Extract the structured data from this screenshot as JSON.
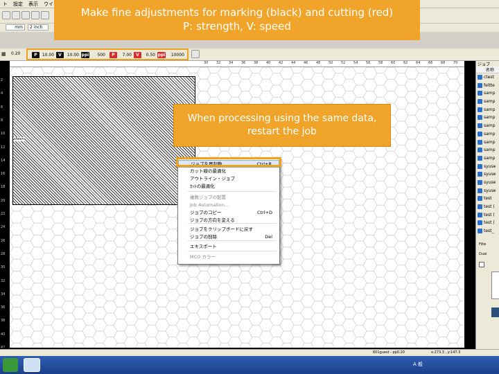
{
  "menubar": {
    "items": [
      "ト",
      "設定",
      "表示",
      "ウイン"
    ]
  },
  "toolbar2": {
    "value1": "mm",
    "value2": "2 inch"
  },
  "toolbar3": {
    "left_value": "0.20"
  },
  "params_black": {
    "p_label": "P",
    "p_value": "10.00",
    "v_label": "V",
    "v_value": "10.00",
    "ppi_value": "500"
  },
  "params_red": {
    "p_label": "P",
    "p_value": "7.00",
    "v_label": "V",
    "v_value": "0.50",
    "ppi_value": "10000"
  },
  "ruler_top": [
    "30",
    "32",
    "34",
    "36",
    "38",
    "40",
    "42",
    "44",
    "46",
    "48",
    "50",
    "52",
    "54",
    "56",
    "58",
    "60",
    "62",
    "64",
    "66",
    "68",
    "70",
    "72"
  ],
  "ruler_left": [
    "2",
    "4",
    "6",
    "8",
    "10",
    "12",
    "14",
    "16",
    "18",
    "20",
    "22",
    "24",
    "26",
    "28",
    "30",
    "32",
    "34",
    "36",
    "38",
    "40",
    "42"
  ],
  "job_label": "sfwen",
  "context_menu": {
    "items": [
      {
        "label": "ジョブを再起動",
        "shortcut": "Ctrl+R",
        "state": "selected"
      },
      {
        "label": "カット線の最適化",
        "shortcut": "",
        "state": "normal"
      },
      {
        "label": "アウトライン・ジョブ",
        "shortcut": "",
        "state": "normal"
      },
      {
        "label": "ｶｯﾄの最適化",
        "shortcut": "",
        "state": "normal"
      },
      {
        "label": "複数ジョブの配置",
        "shortcut": "",
        "state": "disabled"
      },
      {
        "label": "Job Automation...",
        "shortcut": "",
        "state": "disabled"
      },
      {
        "label": "ジョブのコピー",
        "shortcut": "Ctrl+D",
        "state": "normal"
      },
      {
        "label": "ジョブの方向を変える",
        "shortcut": "",
        "state": "normal"
      },
      {
        "label": "ジョブをクリップボードに戻す",
        "shortcut": "",
        "state": "normal"
      },
      {
        "label": "ジョブの削除",
        "shortcut": "Del",
        "state": "normal"
      },
      {
        "label": "エキスポート",
        "shortcut": "",
        "state": "normal"
      },
      {
        "label": "MCO カラー",
        "shortcut": "",
        "state": "disabled"
      }
    ]
  },
  "right_panel": {
    "header": "ジョブ",
    "column": "名称",
    "items": [
      "ctest",
      "feltte",
      "samp",
      "samp",
      "samp",
      "samp",
      "samp",
      "samp",
      "samp",
      "samp",
      "samp",
      "syuse",
      "syuse",
      "syuse",
      "syuse",
      "test",
      "test (",
      "test (",
      "test (",
      "test_"
    ],
    "filter_label": "Filte",
    "dual_label": "Dual"
  },
  "statusbar": {
    "user": "601guest - pp0.20",
    "coords": "x:273.3 , y:147.3"
  },
  "callouts": {
    "top_line1": "Make fine adjustments for marking (black) and cutting (red)",
    "top_line2": "P: strength, V: speed",
    "mid_line1": "When processing using the same data,",
    "mid_line2": "restart the job"
  },
  "taskbar": {
    "tray_text": "A 般"
  },
  "colors": {
    "accent": "#f0a42a",
    "red_badge": "#d92b2b",
    "black_badge": "#111111"
  }
}
